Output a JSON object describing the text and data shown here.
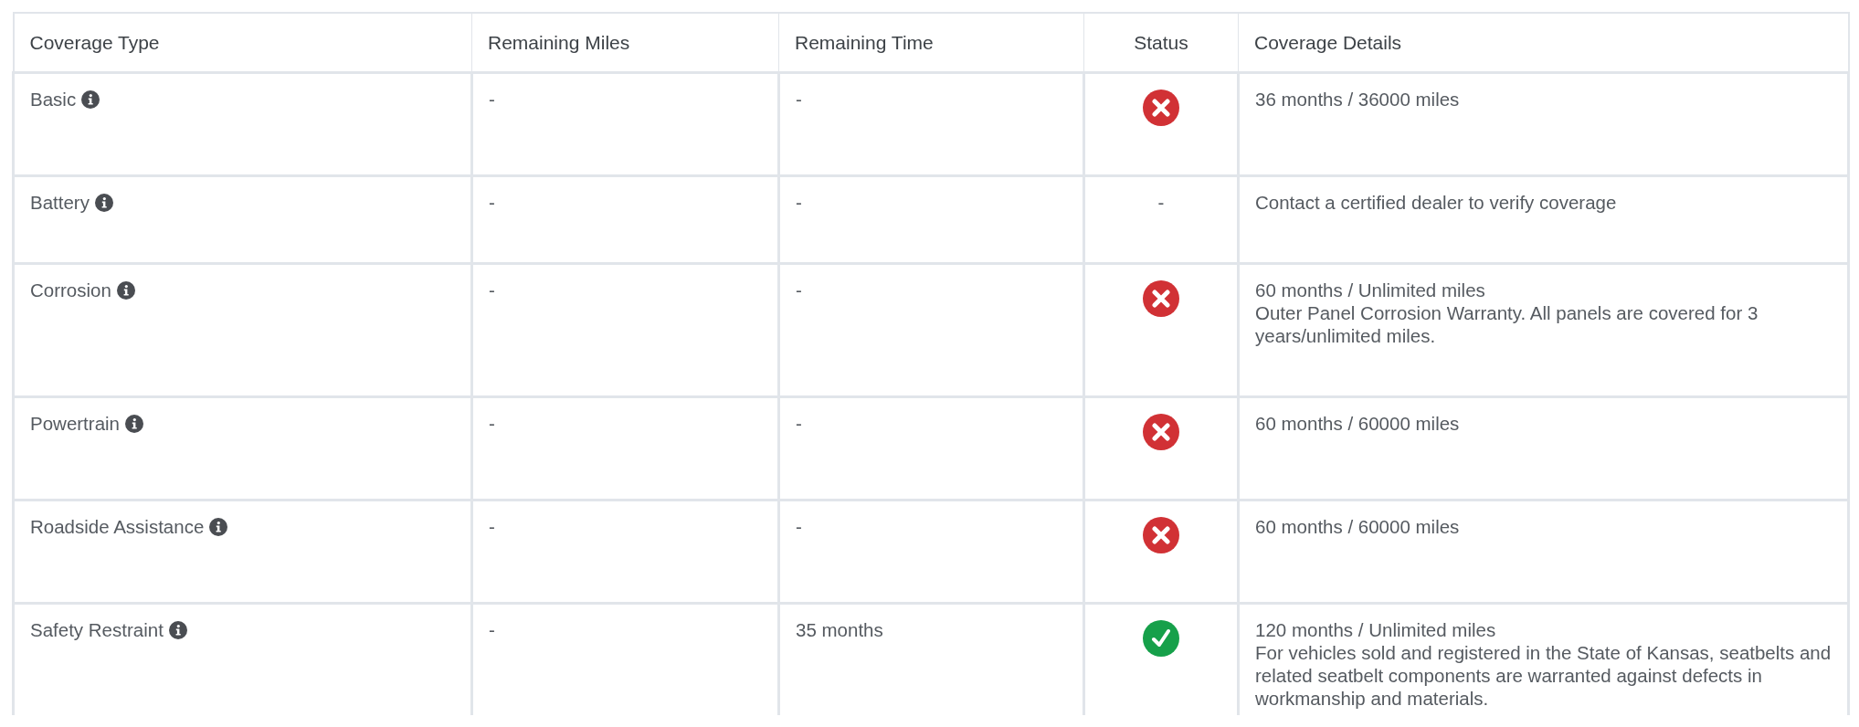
{
  "table": {
    "columns": [
      "Coverage Type",
      "Remaining Miles",
      "Remaining Time",
      "Status",
      "Coverage Details"
    ],
    "rows": [
      {
        "coverage_type": "Basic",
        "remaining_miles": "-",
        "remaining_time": "-",
        "status": {
          "kind": "expired"
        },
        "details": [
          "36 months / 36000 miles"
        ]
      },
      {
        "coverage_type": "Battery",
        "remaining_miles": "-",
        "remaining_time": "-",
        "status": {
          "kind": "text",
          "text": "-"
        },
        "details": [
          "Contact a certified dealer to verify coverage"
        ]
      },
      {
        "coverage_type": "Corrosion",
        "remaining_miles": "-",
        "remaining_time": "-",
        "status": {
          "kind": "expired"
        },
        "details": [
          "60 months / Unlimited miles",
          "Outer Panel Corrosion Warranty. All panels are covered for 3 years/unlimited miles."
        ]
      },
      {
        "coverage_type": "Powertrain",
        "remaining_miles": "-",
        "remaining_time": "-",
        "status": {
          "kind": "expired"
        },
        "details": [
          "60 months / 60000 miles"
        ]
      },
      {
        "coverage_type": "Roadside Assistance",
        "remaining_miles": "-",
        "remaining_time": "-",
        "status": {
          "kind": "expired"
        },
        "details": [
          "60 months / 60000 miles"
        ]
      },
      {
        "coverage_type": "Safety Restraint",
        "remaining_miles": "-",
        "remaining_time": "35 months",
        "status": {
          "kind": "active"
        },
        "details": [
          "120 months / Unlimited miles",
          "For vehicles sold and registered in the State of Kansas, seatbelts and related seatbelt components are warranted against defects in workmanship and materials."
        ]
      }
    ]
  }
}
